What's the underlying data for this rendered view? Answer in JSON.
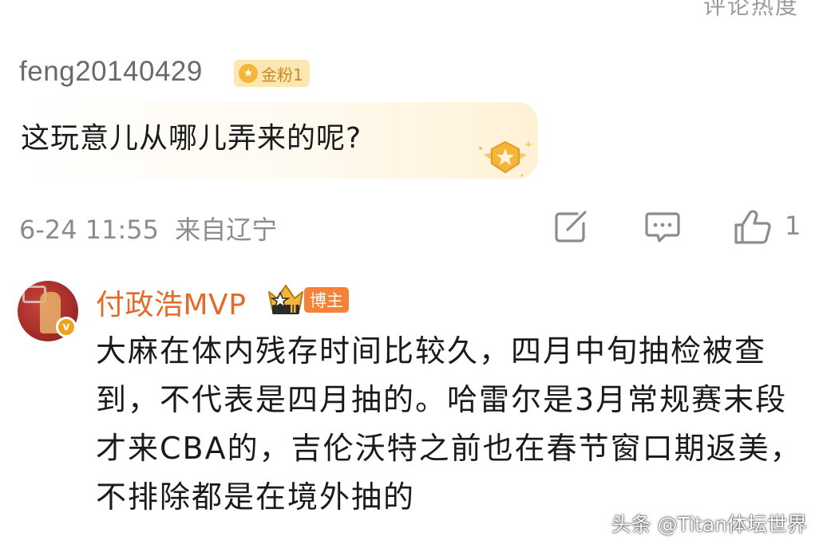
{
  "top_partial_text": "评论热度",
  "comment1": {
    "username": "feng20140429",
    "fan_badge": "金粉1",
    "text": "这玩意儿从哪儿弄来的呢?",
    "timestamp": "6-24 11:55",
    "location": "来自辽宁",
    "like_count": "1",
    "icons": [
      "edit-icon",
      "comment-icon",
      "like-icon"
    ]
  },
  "comment2": {
    "username": "付政浩MVP",
    "badge": "博主",
    "text": "大麻在体内残存时间比较久，四月中旬抽检被查到，不代表是四月抽的。哈雷尔是3月常规赛末段才来CBA的，吉伦沃特之前也在春节窗口期返美，不排除都是在境外抽的"
  },
  "watermark": "头条 @Titan体坛世界",
  "colors": {
    "username_gray": "#6a6a6a",
    "meta_gray": "#8c8c8c",
    "blogger_orange": "#e46a2a",
    "badge_orange": "#f58236",
    "gold": "#f3b53a"
  }
}
